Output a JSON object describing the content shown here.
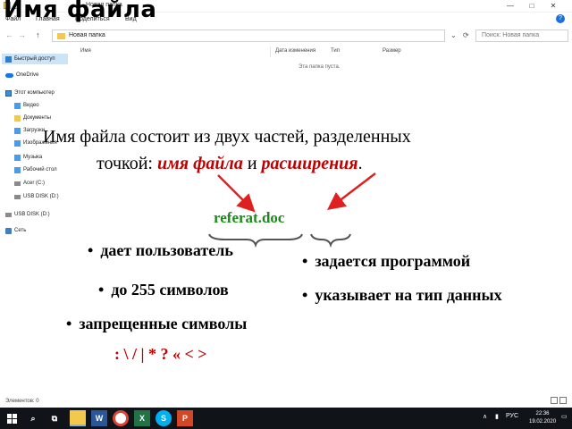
{
  "window": {
    "title": "Новая папка",
    "controls": {
      "minimize": "—",
      "maximize": "□",
      "close": "✕"
    }
  },
  "menubar": {
    "items": [
      "Файл",
      "Главная",
      "Поделиться",
      "Вид"
    ],
    "help": "?"
  },
  "address": {
    "back": "←",
    "forward": "→",
    "up": "↑",
    "path": "Новая папка",
    "refresh": "⟳",
    "search_placeholder": "Поиск: Новая папка"
  },
  "navpane": {
    "items": [
      {
        "label": "Быстрый доступ",
        "icon": "star-icon"
      },
      {
        "label": "OneDrive",
        "icon": "cloud-icon"
      },
      {
        "label": "Этот компьютер",
        "icon": "computer-icon"
      },
      {
        "label": "Видео",
        "icon": "video-icon"
      },
      {
        "label": "Документы",
        "icon": "documents-icon"
      },
      {
        "label": "Загрузки",
        "icon": "downloads-icon"
      },
      {
        "label": "Изображения",
        "icon": "pictures-icon"
      },
      {
        "label": "Музыка",
        "icon": "music-icon"
      },
      {
        "label": "Рабочий стол",
        "icon": "desktop-icon"
      },
      {
        "label": "Acer (C:)",
        "icon": "drive-icon"
      },
      {
        "label": "USB DISK (D:)",
        "icon": "usb-drive-icon"
      },
      {
        "label": "USB DISK (D:)",
        "icon": "usb-drive-icon"
      },
      {
        "label": "Сеть",
        "icon": "network-icon"
      }
    ]
  },
  "columns": [
    "Имя",
    "Дата изменения",
    "Тип",
    "Размер"
  ],
  "empty_message": "Эта папка пуста.",
  "statusbar": "Элементов: 0",
  "taskbar": {
    "search": "⌕",
    "apps": [
      "W",
      "X",
      "P"
    ],
    "tray_symbol": "∧",
    "lang": "РУС",
    "time": "22:36",
    "date": "19.02.2020"
  },
  "slide": {
    "title": "Имя файла",
    "line1": "Имя файла состоит из двух частей, разделенных",
    "line2_prefix": "точкой: ",
    "line2_name": "имя файла",
    "line2_and": " и ",
    "line2_ext": "расширения",
    "line2_suffix": ".",
    "example": "referat.doc",
    "left_bullets": [
      "дает пользователь",
      "до 255 символов",
      "запрещенные символы"
    ],
    "forbidden_chars": ": \\ / | * ? « < >",
    "right_bullets": [
      "задается программой",
      "указывает на тип данных"
    ],
    "accent_color": "#c00000",
    "example_color": "#1a8a1a"
  }
}
